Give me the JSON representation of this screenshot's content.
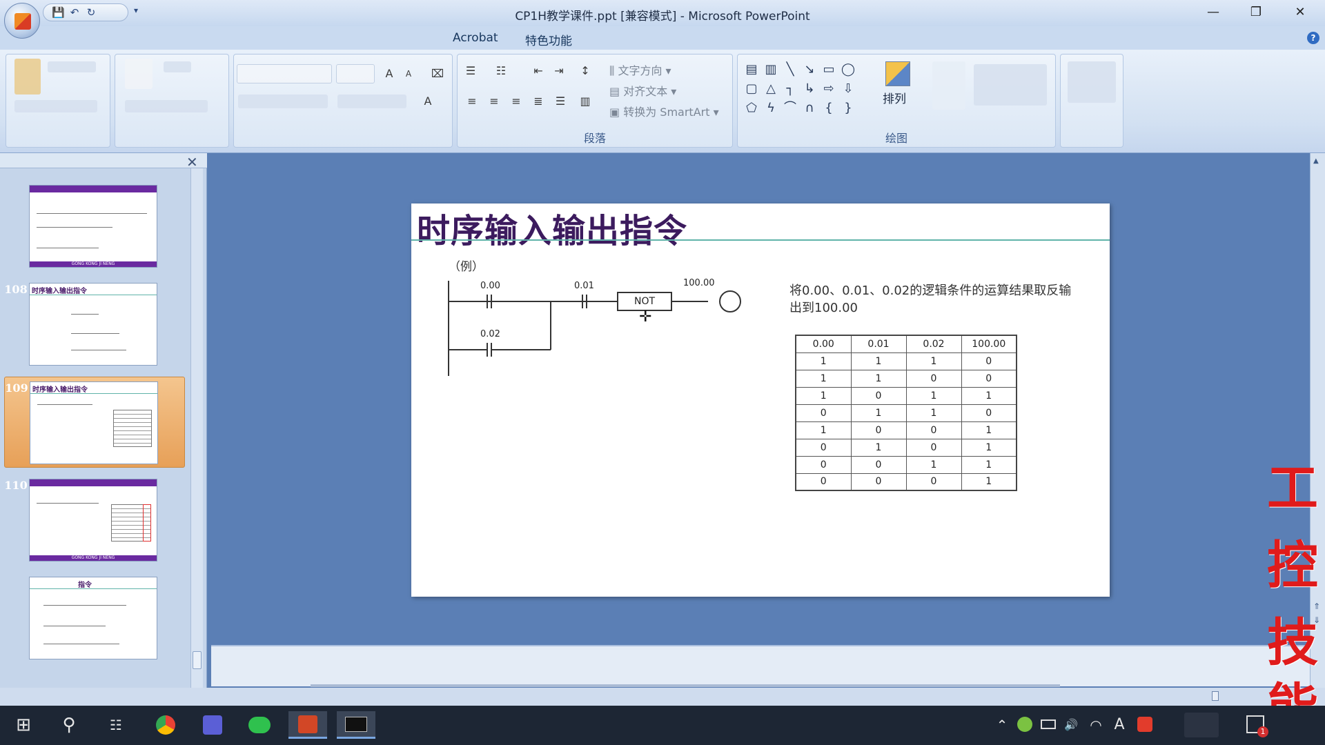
{
  "window": {
    "title": "CP1H教学课件.ppt [兼容模式] - Microsoft PowerPoint",
    "minimize": "—",
    "restore": "❐",
    "close": "✕"
  },
  "qat": {
    "save_icon": "💾",
    "undo_icon": "↶",
    "redo_icon": "↻",
    "more_icon": "▾"
  },
  "ribbon": {
    "tabs": [
      "Acrobat",
      "特色功能"
    ],
    "help_icon": "?",
    "groups": {
      "paragraph": "段落",
      "drawing": "绘图"
    },
    "paragraph_commands": {
      "text_direction": "文字方向",
      "align_text": "对齐文本",
      "convert_smartart": "转换为 SmartArt"
    },
    "arrange_label": "排列"
  },
  "panel": {
    "close_icon": "✕",
    "thumbs": [
      {
        "num": "",
        "title": "",
        "footer": "GONG KONG JI NENG"
      },
      {
        "num": "108",
        "title": "时序输入输出指令",
        "footer": ""
      },
      {
        "num": "109",
        "title": "时序输入输出指令",
        "footer": ""
      },
      {
        "num": "110",
        "title": "",
        "footer": "GONG KONG JI NENG"
      },
      {
        "num": "",
        "title": "指令",
        "footer": ""
      }
    ]
  },
  "slide": {
    "title": "时序输入输出指令",
    "example": "（例）",
    "ladder": {
      "contacts": [
        "0.00",
        "0.01",
        "0.02"
      ],
      "instruction": "NOT",
      "output": "100.00"
    },
    "description": "将0.00、0.01、0.02的逻辑条件的运算结果取反输出到100.00",
    "table": {
      "headers": [
        "0.00",
        "0.01",
        "0.02",
        "100.00"
      ],
      "rows": [
        [
          "1",
          "1",
          "1",
          "0"
        ],
        [
          "1",
          "1",
          "0",
          "0"
        ],
        [
          "1",
          "0",
          "1",
          "1"
        ],
        [
          "0",
          "1",
          "1",
          "0"
        ],
        [
          "1",
          "0",
          "0",
          "1"
        ],
        [
          "0",
          "1",
          "0",
          "1"
        ],
        [
          "0",
          "0",
          "1",
          "1"
        ],
        [
          "0",
          "0",
          "0",
          "1"
        ]
      ]
    }
  },
  "watermark": [
    "工",
    "控",
    "技",
    "能"
  ],
  "taskbar": {
    "start_icon": "⊞",
    "search_icon": "⚲",
    "taskview_icon": "☷",
    "tray": {
      "chevron": "⌃",
      "volume": "🔊",
      "ime": "A",
      "wifi": "◠",
      "notification_badge": "1"
    }
  },
  "colors": {
    "accent": "#3c1b5e",
    "title_rule": "#5fb3a9",
    "watermark": "#e01b1b",
    "selected_thumb": "#e7a058"
  }
}
